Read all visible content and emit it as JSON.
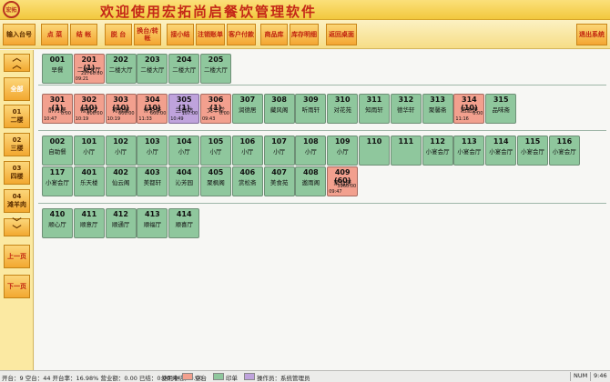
{
  "header": {
    "logo_text": "宏拓",
    "title": "欢迎使用宏拓尚启餐饮管理软件"
  },
  "toolbar": {
    "enter": "输入台号",
    "order": "点 菜",
    "checkout": "结 帐",
    "merge": "脱 台",
    "swap": "换台/转帐",
    "summary": "接小结",
    "cancel": "注销账单",
    "customer": "客户付款",
    "goods": "商品库",
    "stock": "库存明细",
    "back": "返回桌面",
    "exit": "退出系统"
  },
  "left": {
    "all": "全部",
    "floors": [
      {
        "num": "01",
        "name": "二楼"
      },
      {
        "num": "02",
        "name": "三楼"
      },
      {
        "num": "03",
        "name": "四楼"
      },
      {
        "num": "04",
        "name": "滩羊肉"
      }
    ],
    "prev": "上一页",
    "next": "下一页"
  },
  "tables": {
    "row1": [
      {
        "id": "001",
        "name": "早餐",
        "state": "free"
      },
      {
        "id": "201 (1)",
        "name": "二楼大厅",
        "amount": "22760.00",
        "time": "09:21",
        "state": "busy"
      },
      {
        "id": "202",
        "name": "二楼大厅",
        "state": "free"
      },
      {
        "id": "203",
        "name": "二楼大厅",
        "state": "free"
      },
      {
        "id": "204",
        "name": "二楼大厅",
        "state": "free"
      },
      {
        "id": "205",
        "name": "二楼大厅",
        "state": "free"
      }
    ],
    "row2": [
      {
        "id": "301 (1)",
        "name": "醉月居",
        "amount": "0.00",
        "time": "10:47",
        "state": "busy"
      },
      {
        "id": "302 (10)",
        "name": "畅春堂",
        "amount": "600.00",
        "time": "10:19",
        "state": "busy"
      },
      {
        "id": "303 (10)",
        "name": "荷香屋",
        "amount": "600.00",
        "time": "10:19",
        "state": "busy"
      },
      {
        "id": "304 (10)",
        "name": "伴月斋",
        "amount": "600.00",
        "time": "11:33",
        "state": "busy"
      },
      {
        "id": "305 (1)",
        "name": "兰香坊",
        "amount": "107.00",
        "time": "10:49",
        "state": "pay"
      },
      {
        "id": "306 (1)",
        "name": "文华堂",
        "amount": "0.00",
        "time": "09:43",
        "state": "busy"
      },
      {
        "id": "307",
        "name": "润德居",
        "state": "free"
      },
      {
        "id": "308",
        "name": "藏风阁",
        "state": "free"
      },
      {
        "id": "309",
        "name": "听雨轩",
        "state": "free"
      },
      {
        "id": "310",
        "name": "对花苑",
        "state": "free"
      },
      {
        "id": "311",
        "name": "知雨轩",
        "state": "free"
      },
      {
        "id": "312",
        "name": "德华轩",
        "state": "free"
      },
      {
        "id": "313",
        "name": "聚馨斋",
        "state": "free"
      },
      {
        "id": "314 (10)",
        "name": "涵雅居",
        "amount": "0.00",
        "time": "11:16",
        "state": "busy"
      },
      {
        "id": "315",
        "name": "品味斋",
        "state": "free"
      }
    ],
    "row3": [
      {
        "id": "002",
        "name": "自助餐",
        "state": "free"
      },
      {
        "id": "101",
        "name": "小厅",
        "state": "free"
      },
      {
        "id": "102",
        "name": "小厅",
        "state": "free"
      },
      {
        "id": "103",
        "name": "小厅",
        "state": "free"
      },
      {
        "id": "104",
        "name": "小厅",
        "state": "free"
      },
      {
        "id": "105",
        "name": "小厅",
        "state": "free"
      },
      {
        "id": "106",
        "name": "小厅",
        "state": "free"
      },
      {
        "id": "107",
        "name": "小厅",
        "state": "free"
      },
      {
        "id": "108",
        "name": "小厅",
        "state": "free"
      },
      {
        "id": "109",
        "name": "小厅",
        "state": "free"
      },
      {
        "id": "110",
        "name": "",
        "state": "free"
      },
      {
        "id": "111",
        "name": "",
        "state": "free"
      },
      {
        "id": "112",
        "name": "小宴会厅",
        "state": "free"
      },
      {
        "id": "113",
        "name": "小宴会厅",
        "state": "free"
      },
      {
        "id": "114",
        "name": "小宴会厅",
        "state": "free"
      },
      {
        "id": "115",
        "name": "小宴会厅",
        "state": "free"
      },
      {
        "id": "116",
        "name": "小宴会厅",
        "state": "free"
      }
    ],
    "row4": [
      {
        "id": "117",
        "name": "小宴会厅",
        "state": "free"
      },
      {
        "id": "401",
        "name": "乐天楼",
        "state": "free"
      },
      {
        "id": "402",
        "name": "仙云阁",
        "state": "free"
      },
      {
        "id": "403",
        "name": "美都轩",
        "state": "free"
      },
      {
        "id": "404",
        "name": "沁芳园",
        "state": "free"
      },
      {
        "id": "405",
        "name": "聚枫阁",
        "state": "free"
      },
      {
        "id": "406",
        "name": "赏松斋",
        "state": "free"
      },
      {
        "id": "407",
        "name": "美食苑",
        "state": "free"
      },
      {
        "id": "408",
        "name": "邀雨阁",
        "state": "free"
      },
      {
        "id": "409 (60)",
        "name": "聚仙居",
        "amount": "3960.00",
        "time": "09:47",
        "state": "busy"
      }
    ],
    "row5": [
      {
        "id": "410",
        "name": "顺心厅",
        "state": "free"
      },
      {
        "id": "411",
        "name": "顺意厅",
        "state": "free"
      },
      {
        "id": "412",
        "name": "顺通厅",
        "state": "free"
      },
      {
        "id": "413",
        "name": "顺福厅",
        "state": "free"
      },
      {
        "id": "414",
        "name": "顺喜厅",
        "state": "free"
      }
    ]
  },
  "status": {
    "stats": "开台：9 空台：44 开台率：16.98% 营业额：0.00 已结：0.00 未结：0.00",
    "in_use": "使用中",
    "free": "空台",
    "reserved": "印单",
    "operator": "操作员：系统管理员",
    "num": "NUM",
    "time": "9:46"
  },
  "colors": {
    "free": "#8fc79d",
    "busy": "#f2a08e",
    "pay": "#bfa3dc"
  }
}
